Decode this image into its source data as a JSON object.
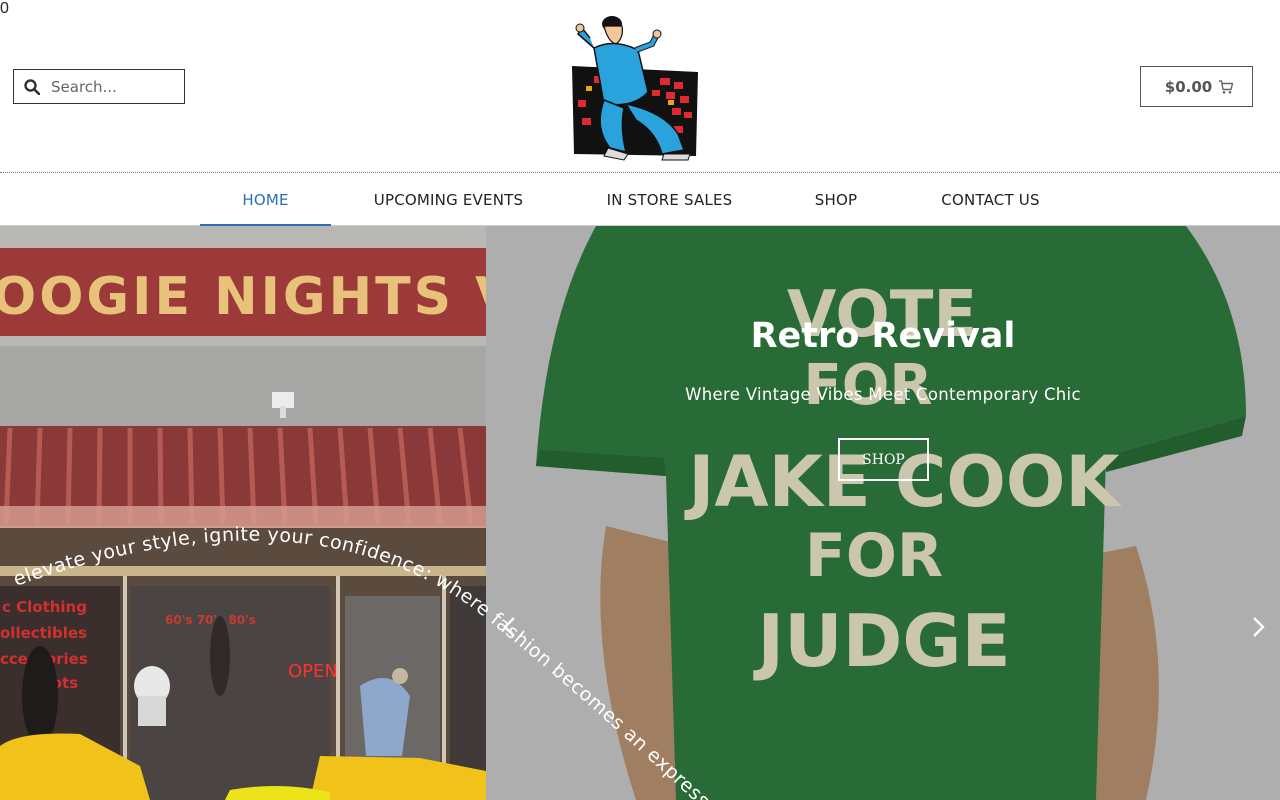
{
  "search": {
    "placeholder": "Search..."
  },
  "cart": {
    "amount": "$0.00",
    "count": "0"
  },
  "nav": {
    "items": [
      {
        "label": "HOME"
      },
      {
        "label": "UPCOMING EVENTS"
      },
      {
        "label": "IN STORE SALES"
      },
      {
        "label": "SHOP"
      },
      {
        "label": "CONTACT US"
      }
    ]
  },
  "hero": {
    "storefront_sign": "OOGIE NIGHTS VINT",
    "storefront_window": [
      "c Clothing",
      "ollectibles",
      "ccessories",
      "Boots"
    ],
    "storefront_open": "OPEN",
    "window_decades": "60's 70's 80's",
    "tshirt_lines": [
      "VOTE",
      "FOR",
      "JAKE COOK",
      "FOR",
      "JUDGE"
    ],
    "curved_text": "elevate your style, ignite your confidence: where fashion becomes an expression o",
    "slide_title": "Retro Revival",
    "slide_subtitle": "Where Vintage Vibes Meet Contemporary Chic",
    "slide_button": "SHOP"
  },
  "colors": {
    "accent": "#2a6fb4",
    "badge": "#d9433a",
    "shirt": "#2f7a3e",
    "sign": "#9c3a3a"
  },
  "icons": {
    "search": "search-icon",
    "cart": "cart-icon",
    "prev": "chevron-left-icon",
    "next": "chevron-right-icon"
  }
}
